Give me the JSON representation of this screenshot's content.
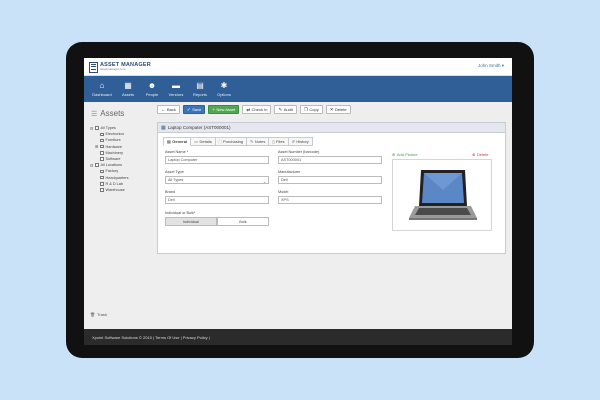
{
  "header": {
    "logo_title": "ASSET MANAGER",
    "logo_subtitle": "assetmanager.com",
    "user": "John Smith ▾"
  },
  "nav": [
    {
      "label": "Dashboard",
      "icon": "home-icon"
    },
    {
      "label": "Assets",
      "icon": "assets-icon"
    },
    {
      "label": "People",
      "icon": "people-icon"
    },
    {
      "label": "Vendors",
      "icon": "truck-icon"
    },
    {
      "label": "Reports",
      "icon": "reports-icon"
    },
    {
      "label": "Options",
      "icon": "gear-icon"
    }
  ],
  "sidebar": {
    "title": "Assets",
    "tree": [
      {
        "label": "All Types",
        "toggle": "⊟",
        "level": 0
      },
      {
        "label": "Electronics",
        "level": 1
      },
      {
        "label": "Furniture",
        "level": 1
      },
      {
        "label": "Hardware",
        "toggle": "⊞",
        "level": 1
      },
      {
        "label": "Machinery",
        "level": 1
      },
      {
        "label": "Software",
        "level": 1
      },
      {
        "label": "All Locations",
        "toggle": "⊟",
        "level": 0
      },
      {
        "label": "Factory",
        "level": 1
      },
      {
        "label": "Headquarters",
        "level": 1
      },
      {
        "label": "R & D Lab",
        "level": 1
      },
      {
        "label": "Warehouse",
        "level": 1
      }
    ],
    "trash_label": "Trash"
  },
  "toolbar": {
    "back": "Back",
    "save": "Save",
    "new_asset": "New Asset",
    "check_in": "Check In",
    "audit": "Audit",
    "copy": "Copy",
    "delete": "Delete"
  },
  "panel": {
    "title": "Laptop Computer (AST000001)",
    "tabs": [
      "General",
      "Details",
      "Purchasing",
      "Notes",
      "Files",
      "History"
    ],
    "active_tab": "General"
  },
  "form": {
    "asset_name_label": "Asset Name *",
    "asset_name_value": "Laptop Computer",
    "asset_number_label": "Asset Number (barcode)",
    "asset_number_value": "AST000001",
    "asset_type_label": "Asset Type",
    "asset_type_value": "All Types",
    "manufacturer_label": "Manufacturer",
    "manufacturer_value": "Dell",
    "brand_label": "Brand",
    "brand_value": "Dell",
    "model_label": "Model",
    "model_value": "XPS",
    "individual_bulk_label": "Individual or Bulk*",
    "individual_option": "Individual",
    "bulk_option": "Bulk",
    "selected_option": "Individual"
  },
  "picture": {
    "add_label": "Add Picture",
    "delete_label": "Delete"
  },
  "footer": {
    "text": "Xpoint Software Solutions © 2015 | Terms Of Use | Privacy Policy |"
  }
}
